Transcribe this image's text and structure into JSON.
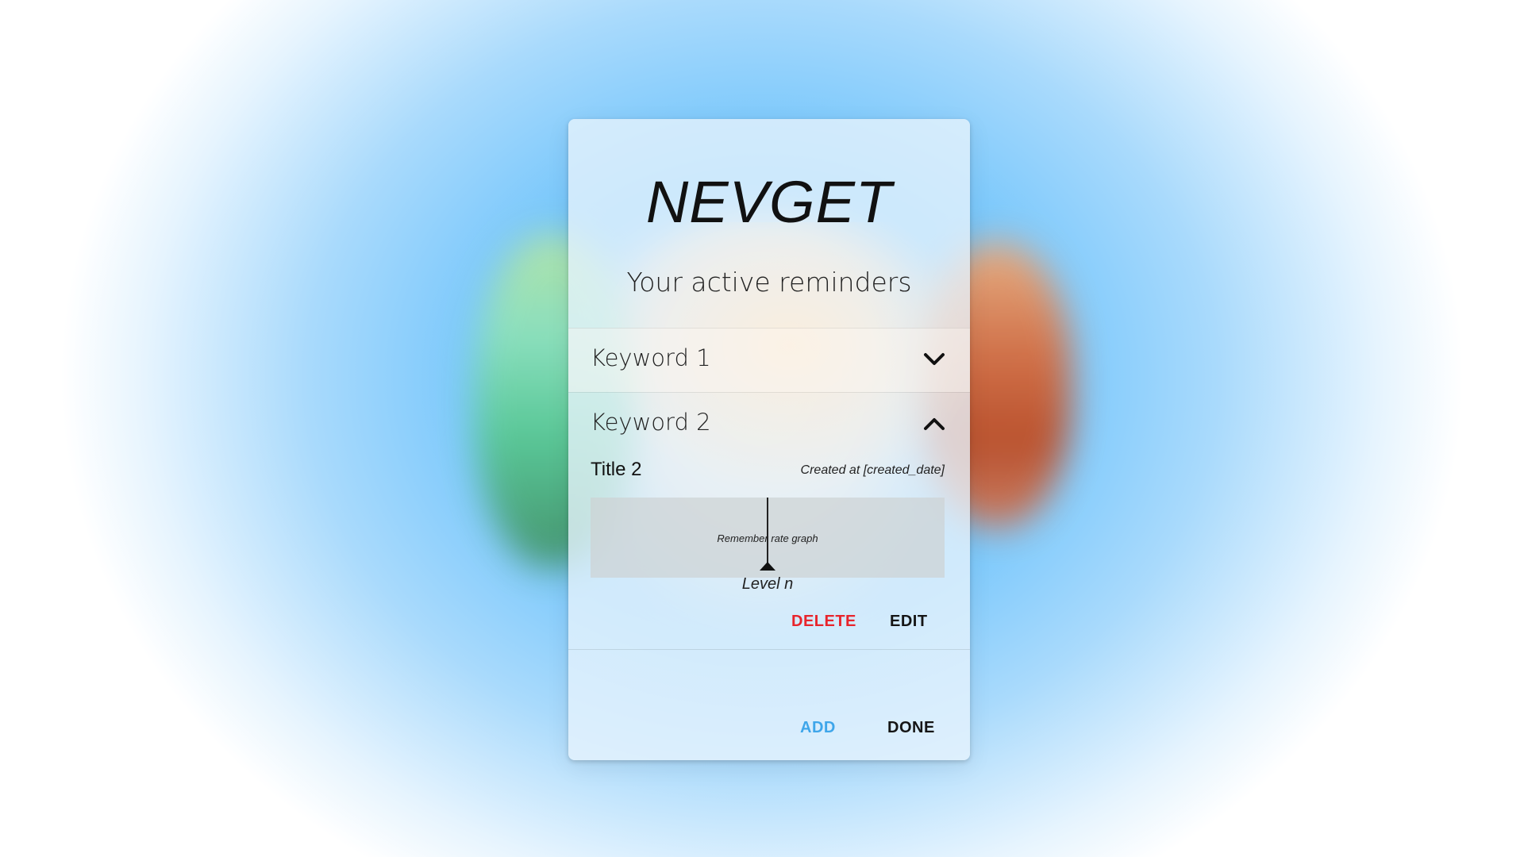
{
  "app": {
    "title": "NEVGET",
    "subtitle": "Your active reminders"
  },
  "reminders": [
    {
      "keyword": "Keyword 1",
      "expanded": false,
      "chevron_icon": "chevron-down-icon"
    },
    {
      "keyword": "Keyword 2",
      "expanded": true,
      "chevron_icon": "chevron-up-icon",
      "title": "Title 2",
      "created_label": "Created at [created_date]",
      "graph_label": "Remember rate graph",
      "level_label": "Level n",
      "actions": {
        "delete": "DELETE",
        "edit": "EDIT"
      }
    }
  ],
  "footer": {
    "add_label": "ADD",
    "done_label": "DONE"
  },
  "colors": {
    "delete": "#e8242c",
    "add": "#3fa6ea",
    "background": "#5cbcfb"
  }
}
